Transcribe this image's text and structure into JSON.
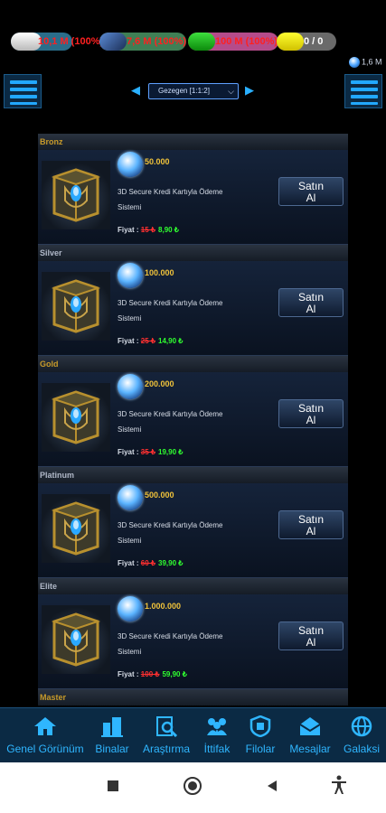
{
  "resources": {
    "metal": "10,1 M (100%)",
    "crystal": "7,6 M (100%)",
    "deuterium": "100 M (100%)",
    "energy": "0 / 0"
  },
  "dark_matter": "1,6 M",
  "planet_selector": "Gezegen [1:1:2]",
  "currency": {
    "price_label": "Fiyat :",
    "buy_label_line1": "Satın",
    "buy_label_line2": "Al"
  },
  "packages": [
    {
      "tier": "Bronz",
      "amount": "50.000",
      "method_line1": "3D Secure Kredi Kartıyla Ödeme",
      "method_line2": "Sistemi",
      "old_price": "15 ₺",
      "new_price": "8,90 ₺"
    },
    {
      "tier": "Silver",
      "amount": "100.000",
      "method_line1": "3D Secure Kredi Kartıyla Ödeme",
      "method_line2": "Sistemi",
      "old_price": "25 ₺",
      "new_price": "14,90 ₺"
    },
    {
      "tier": "Gold",
      "amount": "200.000",
      "method_line1": "3D Secure Kredi Kartıyla Ödeme",
      "method_line2": "Sistemi",
      "old_price": "35 ₺",
      "new_price": "19,90 ₺"
    },
    {
      "tier": "Platinum",
      "amount": "500.000",
      "method_line1": "3D Secure Kredi Kartıyla Ödeme",
      "method_line2": "Sistemi",
      "old_price": "60 ₺",
      "new_price": "39,90 ₺"
    },
    {
      "tier": "Elite",
      "amount": "1.000.000",
      "method_line1": "3D Secure Kredi Kartıyla Ödeme",
      "method_line2": "Sistemi",
      "old_price": "100 ₺",
      "new_price": "59,90 ₺"
    }
  ],
  "partial_tier": "Master",
  "bottom_nav": [
    {
      "label": "Genel Görünüm",
      "icon": "home-icon"
    },
    {
      "label": "Binalar",
      "icon": "buildings-icon"
    },
    {
      "label": "Araştırma",
      "icon": "research-icon"
    },
    {
      "label": "İttifak",
      "icon": "alliance-icon"
    },
    {
      "label": "Filolar",
      "icon": "fleet-icon"
    },
    {
      "label": "Mesajlar",
      "icon": "messages-icon"
    },
    {
      "label": "Galaksi",
      "icon": "galaxy-icon"
    }
  ],
  "colors": {
    "accent": "#2fb6ff",
    "tier_gold": "#c79a2a",
    "old_price": "#ff3030",
    "new_price": "#30ff30",
    "amount": "#f0c23a"
  }
}
